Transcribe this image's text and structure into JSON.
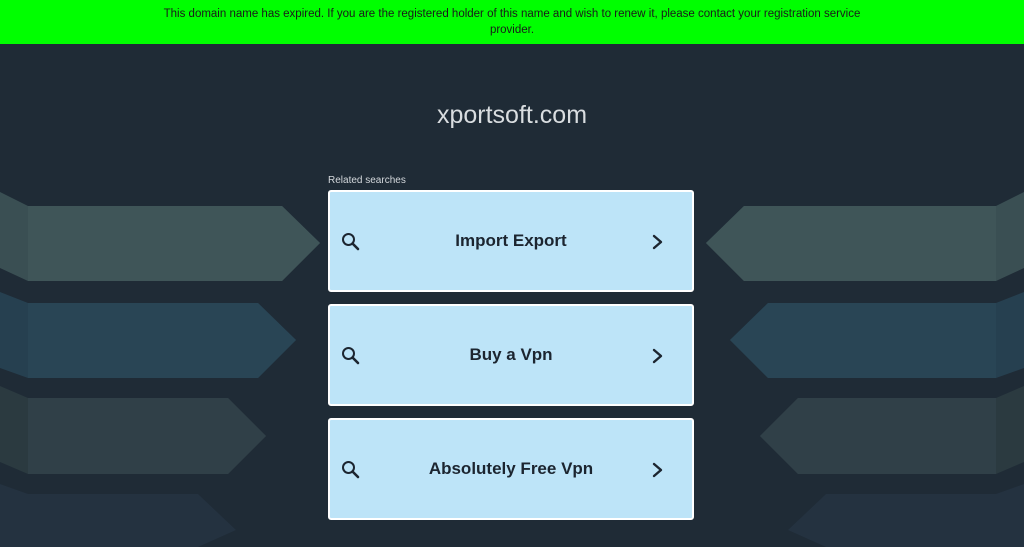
{
  "banner": {
    "text": "This domain name has expired. If you are the registered holder of this name and wish to renew it, please contact your registration service provider."
  },
  "domain": "xportsoft.com",
  "related_label": "Related searches",
  "results": [
    {
      "label": "Import Export"
    },
    {
      "label": "Buy a Vpn"
    },
    {
      "label": "Absolutely Free Vpn"
    }
  ],
  "colors": {
    "banner_bg": "#00ff00",
    "page_bg": "#1f2b36",
    "card_bg": "#bde4f8",
    "card_border": "#ffffff",
    "arrow_teal": "#3f5558",
    "arrow_blue": "#294555",
    "arrow_grey": "#304048"
  },
  "icons": {
    "search": "search-icon",
    "chevron": "chevron-right-icon"
  }
}
